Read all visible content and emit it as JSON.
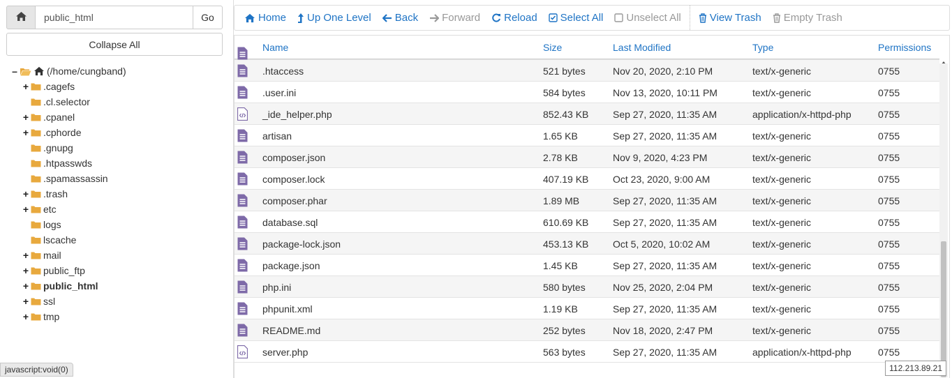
{
  "path_bar": {
    "value": "public_html",
    "go_label": "Go"
  },
  "collapse_label": "Collapse All",
  "tree": {
    "root": "(/home/cungband)",
    "items": [
      {
        "label": ".cagefs",
        "toggle": "+"
      },
      {
        "label": ".cl.selector",
        "toggle": ""
      },
      {
        "label": ".cpanel",
        "toggle": "+"
      },
      {
        "label": ".cphorde",
        "toggle": "+"
      },
      {
        "label": ".gnupg",
        "toggle": ""
      },
      {
        "label": ".htpasswds",
        "toggle": ""
      },
      {
        "label": ".spamassassin",
        "toggle": ""
      },
      {
        "label": ".trash",
        "toggle": "+"
      },
      {
        "label": "etc",
        "toggle": "+"
      },
      {
        "label": "logs",
        "toggle": ""
      },
      {
        "label": "lscache",
        "toggle": ""
      },
      {
        "label": "mail",
        "toggle": "+"
      },
      {
        "label": "public_ftp",
        "toggle": "+"
      },
      {
        "label": "public_html",
        "toggle": "+",
        "selected": true
      },
      {
        "label": "ssl",
        "toggle": "+"
      },
      {
        "label": "tmp",
        "toggle": "+"
      }
    ]
  },
  "status_tip": "javascript:void(0)",
  "toolbar": {
    "home": "Home",
    "up": "Up One Level",
    "back": "Back",
    "forward": "Forward",
    "reload": "Reload",
    "select_all": "Select All",
    "unselect_all": "Unselect All",
    "view_trash": "View Trash",
    "empty_trash": "Empty Trash"
  },
  "table": {
    "headers": {
      "name": "Name",
      "size": "Size",
      "modified": "Last Modified",
      "type": "Type",
      "perms": "Permissions"
    },
    "rows": [
      {
        "name": ".htaccess",
        "size": "521 bytes",
        "modified": "Nov 20, 2020, 2:10 PM",
        "type": "text/x-generic",
        "perms": "0755",
        "icon": "text-file-icon"
      },
      {
        "name": ".user.ini",
        "size": "584 bytes",
        "modified": "Nov 13, 2020, 10:11 PM",
        "type": "text/x-generic",
        "perms": "0755",
        "icon": "text-file-icon"
      },
      {
        "name": "_ide_helper.php",
        "size": "852.43 KB",
        "modified": "Sep 27, 2020, 11:35 AM",
        "type": "application/x-httpd-php",
        "perms": "0755",
        "icon": "code-file-icon"
      },
      {
        "name": "artisan",
        "size": "1.65 KB",
        "modified": "Sep 27, 2020, 11:35 AM",
        "type": "text/x-generic",
        "perms": "0755",
        "icon": "text-file-icon"
      },
      {
        "name": "composer.json",
        "size": "2.78 KB",
        "modified": "Nov 9, 2020, 4:23 PM",
        "type": "text/x-generic",
        "perms": "0755",
        "icon": "text-file-icon"
      },
      {
        "name": "composer.lock",
        "size": "407.19 KB",
        "modified": "Oct 23, 2020, 9:00 AM",
        "type": "text/x-generic",
        "perms": "0755",
        "icon": "text-file-icon"
      },
      {
        "name": "composer.phar",
        "size": "1.89 MB",
        "modified": "Sep 27, 2020, 11:35 AM",
        "type": "text/x-generic",
        "perms": "0755",
        "icon": "text-file-icon"
      },
      {
        "name": "database.sql",
        "size": "610.69 KB",
        "modified": "Sep 27, 2020, 11:35 AM",
        "type": "text/x-generic",
        "perms": "0755",
        "icon": "text-file-icon"
      },
      {
        "name": "package-lock.json",
        "size": "453.13 KB",
        "modified": "Oct 5, 2020, 10:02 AM",
        "type": "text/x-generic",
        "perms": "0755",
        "icon": "text-file-icon"
      },
      {
        "name": "package.json",
        "size": "1.45 KB",
        "modified": "Sep 27, 2020, 11:35 AM",
        "type": "text/x-generic",
        "perms": "0755",
        "icon": "text-file-icon"
      },
      {
        "name": "php.ini",
        "size": "580 bytes",
        "modified": "Nov 25, 2020, 2:04 PM",
        "type": "text/x-generic",
        "perms": "0755",
        "icon": "text-file-icon"
      },
      {
        "name": "phpunit.xml",
        "size": "1.19 KB",
        "modified": "Sep 27, 2020, 11:35 AM",
        "type": "text/x-generic",
        "perms": "0755",
        "icon": "text-file-icon"
      },
      {
        "name": "README.md",
        "size": "252 bytes",
        "modified": "Nov 18, 2020, 2:47 PM",
        "type": "text/x-generic",
        "perms": "0755",
        "icon": "text-file-icon"
      },
      {
        "name": "server.php",
        "size": "563 bytes",
        "modified": "Sep 27, 2020, 11:35 AM",
        "type": "application/x-httpd-php",
        "perms": "0755",
        "icon": "code-file-icon"
      }
    ]
  },
  "ip_badge": "112.213.89.21",
  "colors": {
    "link": "#1f74c5",
    "folder": "#e8a93e",
    "file_icon": "#7e6aa8",
    "disabled": "#999999"
  }
}
